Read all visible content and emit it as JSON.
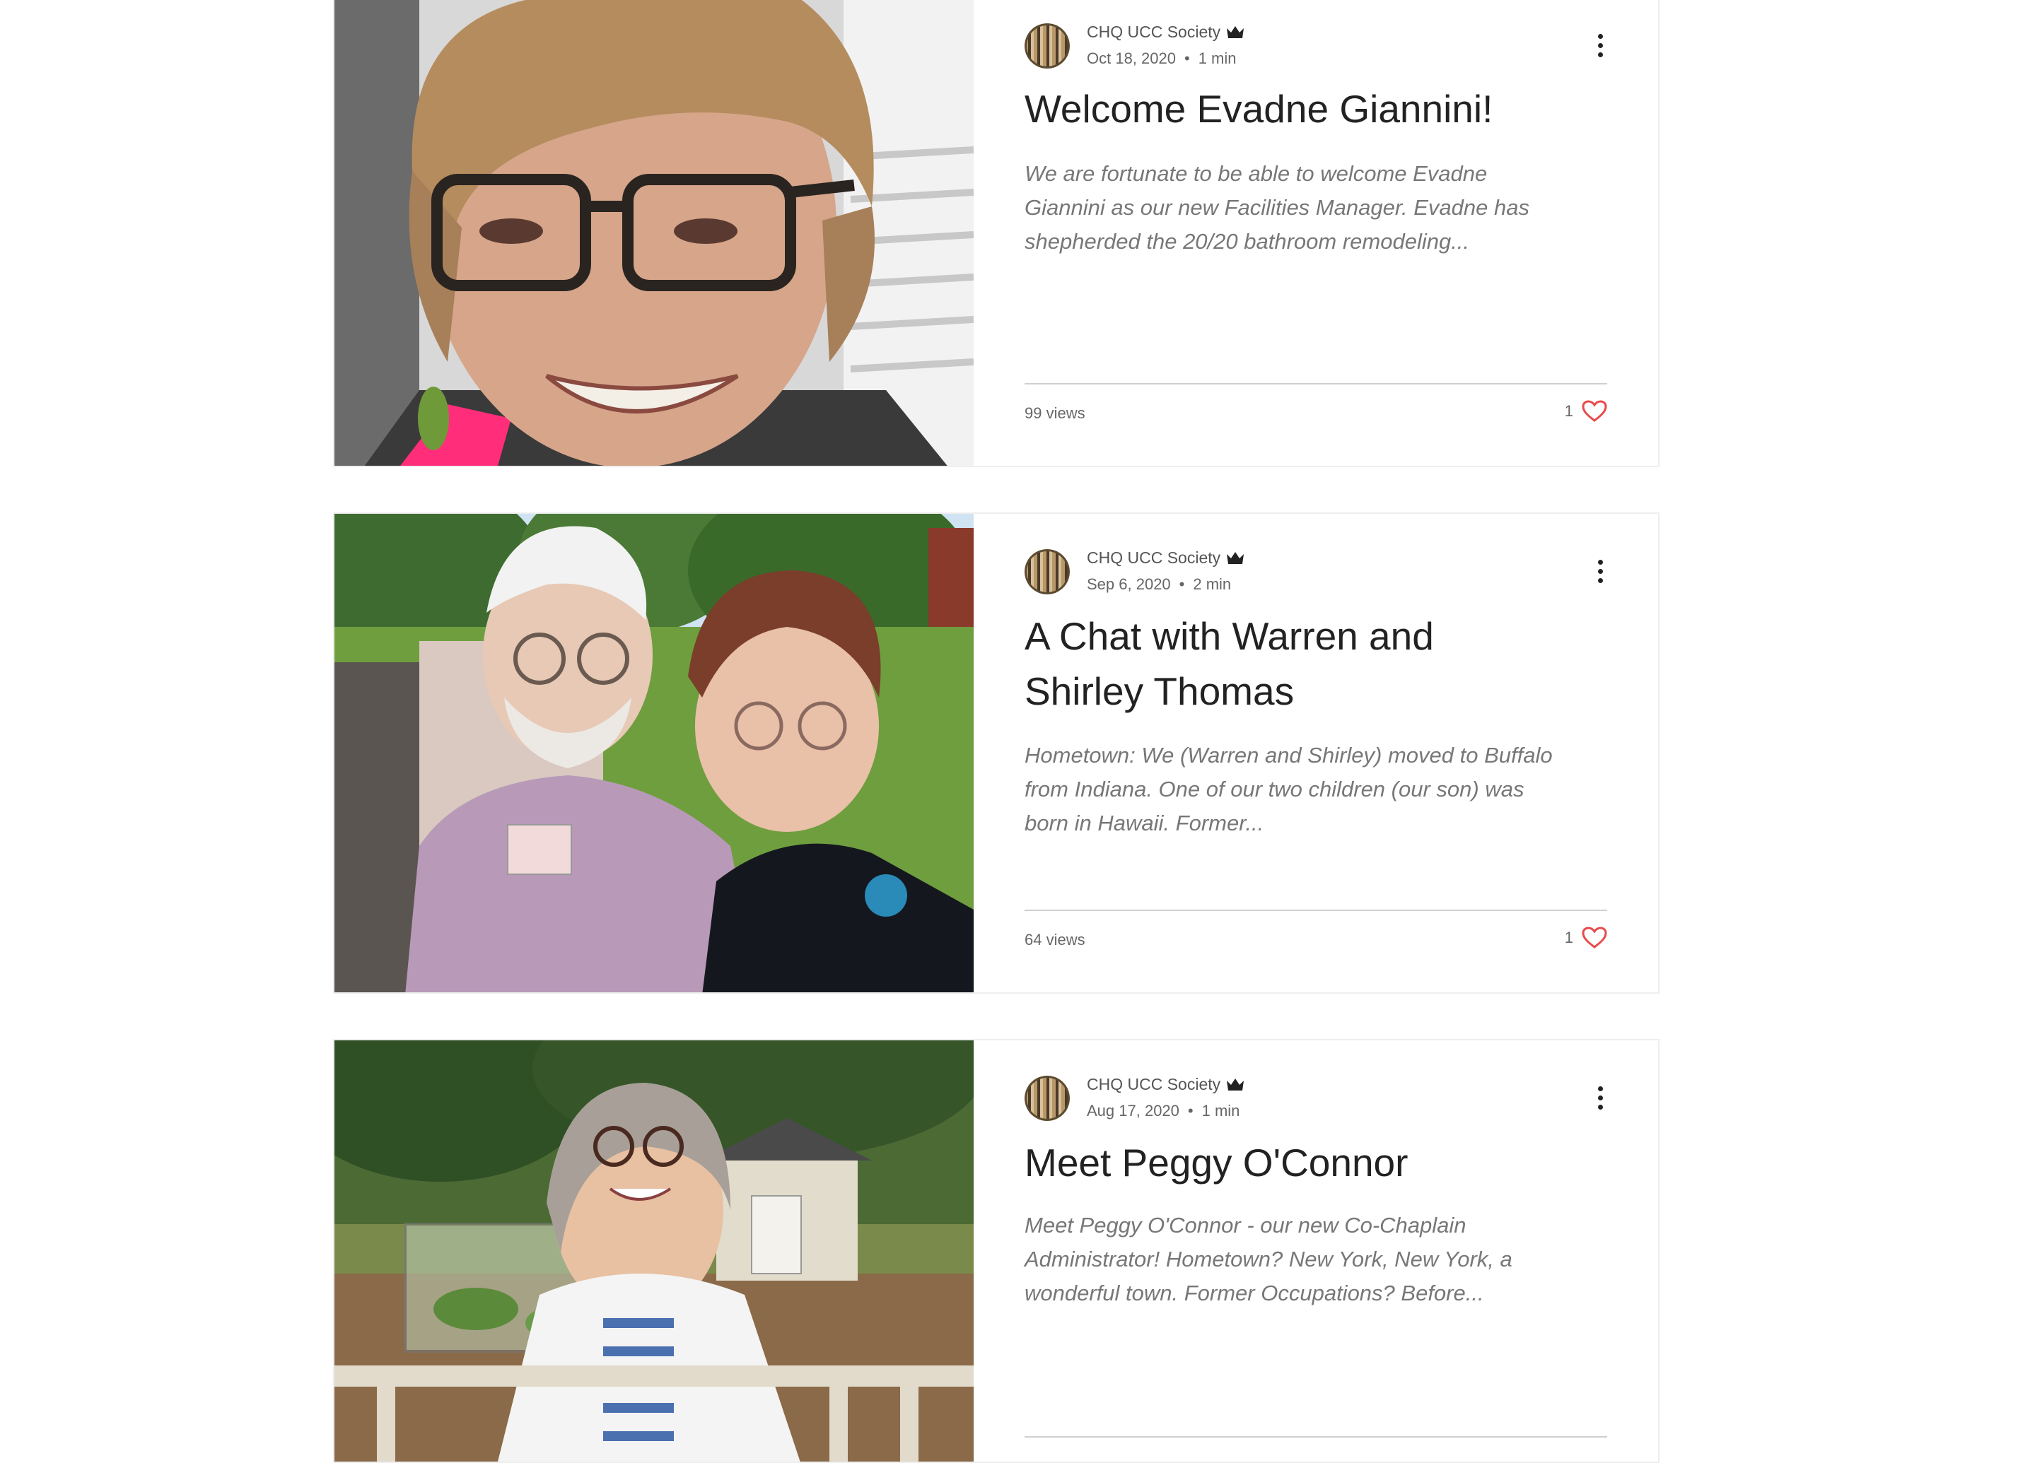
{
  "accent_color": "#e84a4a",
  "posts": [
    {
      "author": "CHQ UCC Society",
      "date": "Oct 18, 2020",
      "read_time": "1 min",
      "title": "Welcome Evadne Giannini!",
      "excerpt": "We are fortunate to be able to welcome Evadne Giannini as our new Facilities Manager. Evadne has shepherded the 20/20 bathroom remodeling...",
      "views": "99 views",
      "likes": "1"
    },
    {
      "author": "CHQ UCC Society",
      "date": "Sep 6, 2020",
      "read_time": "2 min",
      "title": "A Chat with Warren and Shirley Thomas",
      "excerpt": "Hometown: We (Warren and Shirley) moved to Buffalo from Indiana. One of our two children (our son) was born in Hawaii. Former...",
      "views": "64 views",
      "likes": "1"
    },
    {
      "author": "CHQ UCC Society",
      "date": "Aug 17, 2020",
      "read_time": "1 min",
      "title": "Meet Peggy O'Connor",
      "excerpt": "Meet Peggy O'Connor - our new Co-Chaplain Administrator! Hometown? New York, New York, a wonderful town. Former Occupations? Before...",
      "views": "",
      "likes": ""
    }
  ]
}
